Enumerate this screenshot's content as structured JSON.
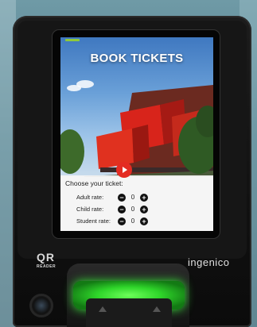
{
  "screen": {
    "title": "BOOK TICKETS",
    "panel_heading": "Choose your ticket:",
    "rates": [
      {
        "label": "Adult rate:",
        "quantity": "0"
      },
      {
        "label": "Child rate:",
        "quantity": "0"
      },
      {
        "label": "Student rate:",
        "quantity": "0"
      }
    ],
    "minus_symbol": "−",
    "plus_symbol": "+"
  },
  "device": {
    "qr_logo": "QR",
    "qr_sub": "READER",
    "brand": "ingenico"
  },
  "colors": {
    "go_button": "#e42b22",
    "reader_light": "#39e43a",
    "status_indicator": "#8fc93a"
  }
}
